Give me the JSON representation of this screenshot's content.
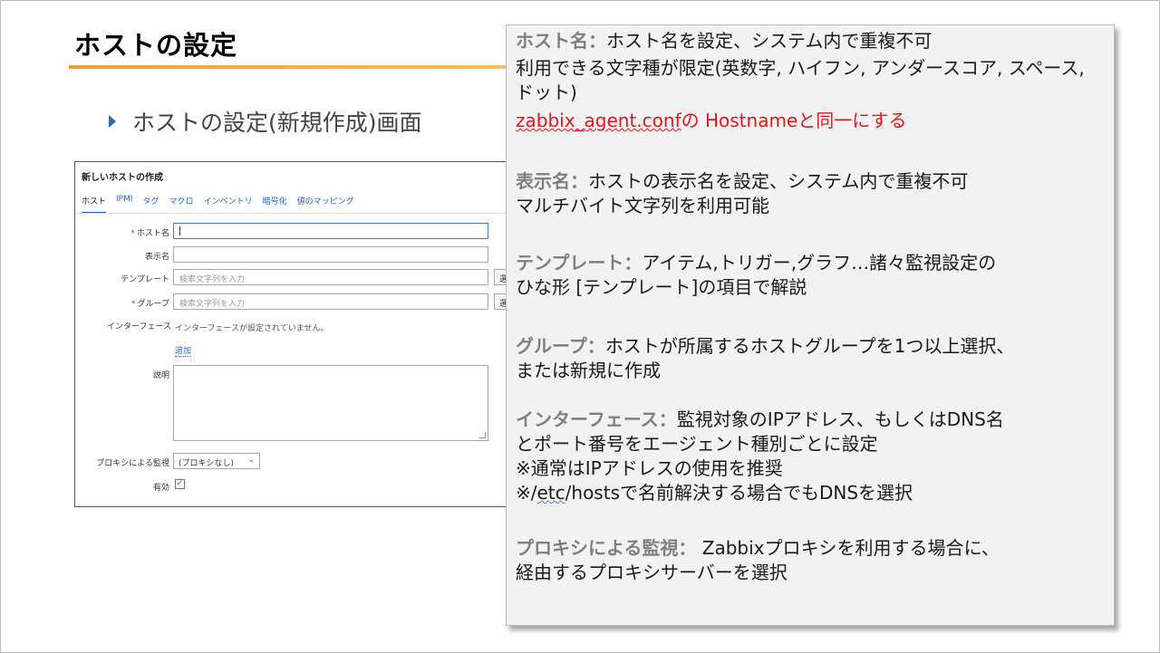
{
  "slide": {
    "title": "ホストの設定",
    "bullet": "ホストの設定(新規作成)画面"
  },
  "form": {
    "title": "新しいホストの作成",
    "tabs": [
      "ホスト",
      "IPMI",
      "タグ",
      "マクロ",
      "インベントリ",
      "暗号化",
      "値のマッピング"
    ],
    "required_mark": "*",
    "host_name_label": "ホスト名",
    "display_name_label": "表示名",
    "template_label": "テンプレート",
    "template_placeholder": "検索文字列を入力",
    "select_label": "選",
    "group_label": "グループ",
    "group_placeholder": "検索文字列を入力",
    "interface_label": "インターフェース",
    "interface_text": "インターフェースが設定されていません。",
    "add_link": "追加",
    "description_label": "説明",
    "proxy_label": "プロキシによる監視",
    "proxy_value": "(プロキシなし)",
    "enabled_label": "有効",
    "enabled_checked": true
  },
  "callout": {
    "host": {
      "term": "ホスト名：",
      "line1": "ホスト名を設定、システム内で重複不可",
      "line2": "利用できる文字種が限定(英数字, ハイフン, アンダースコア, スペース, ドット)",
      "red_link": "zabbix_agent.conf",
      "red_rest": "の Hostnameと同一にする"
    },
    "display": {
      "term": "表示名：",
      "line1": "ホストの表示名を設定、システム内で重複不可",
      "line2": "マルチバイト文字列を利用可能"
    },
    "template": {
      "term": "テンプレート：",
      "line1": "アイテム,トリガー,グラフ…諸々監視設定の",
      "line2": "ひな形 [テンプレート]の項目で解説"
    },
    "group": {
      "term": "グループ：",
      "line1": "ホストが所属するホストグループを1つ以上選択、",
      "line2": "または新規に作成"
    },
    "interface": {
      "term": "インターフェース：",
      "line1": "監視対象のIPアドレス、もしくはDNS名",
      "line2": "とポート番号をエージェント種別ごとに設定",
      "line3": "※通常はIPアドレスの使用を推奨",
      "line4_pre": "※/",
      "line4_etc": "etc",
      "line4_post": "/hostsで名前解決する場合でもDNSを選択"
    },
    "proxy": {
      "term": "プロキシによる監視：",
      "line1": " Zabbixプロキシを利用する場合に、",
      "line2": "経由するプロキシサーバーを選択"
    }
  },
  "colors": {
    "accent_underline": "#f0a030",
    "link_blue": "#1f65c0",
    "term_gray": "#7f7f7f",
    "warning_red": "#e8141b"
  }
}
